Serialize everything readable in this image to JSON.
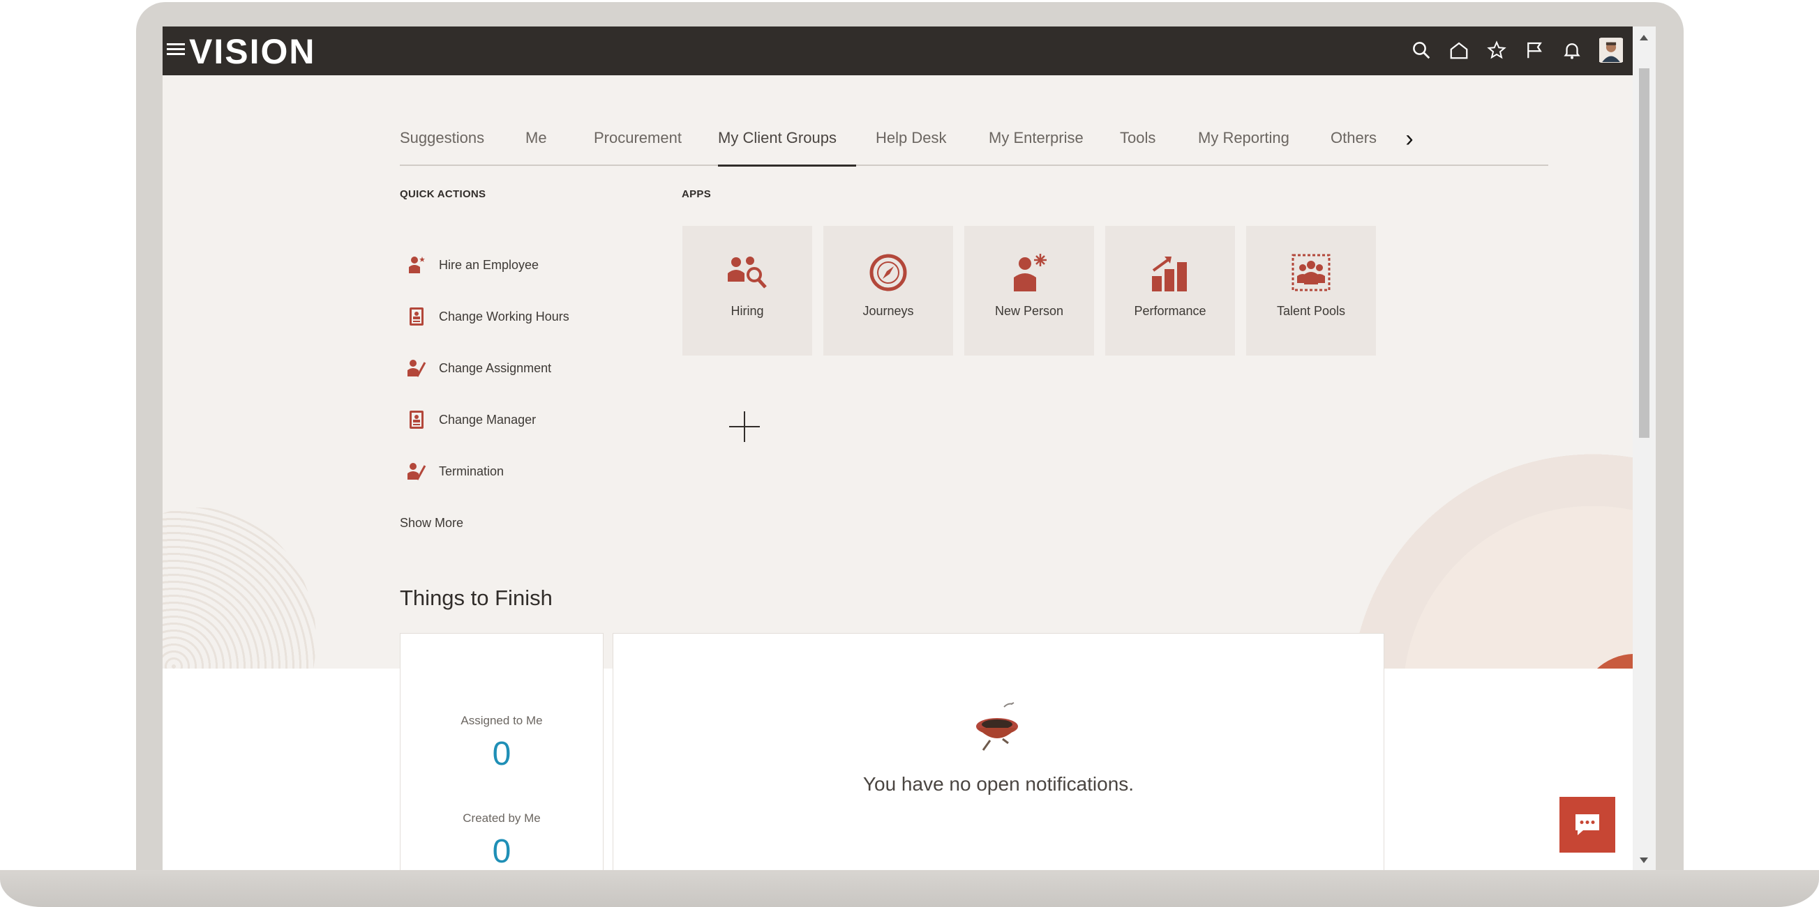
{
  "brand": {
    "logo": "VISION",
    "accent": "#c74634",
    "header_bg": "#312d2a"
  },
  "header": {
    "icons": [
      "search-icon",
      "home-icon",
      "star-icon",
      "flag-icon",
      "bell-icon",
      "avatar"
    ]
  },
  "tabs": [
    {
      "label": "Suggestions"
    },
    {
      "label": "Me"
    },
    {
      "label": "Procurement"
    },
    {
      "label": "My Client Groups",
      "active": true
    },
    {
      "label": "Help Desk"
    },
    {
      "label": "My Enterprise"
    },
    {
      "label": "Tools"
    },
    {
      "label": "My Reporting"
    },
    {
      "label": "Others"
    }
  ],
  "quick_actions": {
    "heading": "QUICK ACTIONS",
    "items": [
      {
        "label": "Hire an Employee",
        "icon": "hire-employee-icon"
      },
      {
        "label": "Change Working Hours",
        "icon": "badge-icon"
      },
      {
        "label": "Change Assignment",
        "icon": "edit-person-icon"
      },
      {
        "label": "Change Manager",
        "icon": "badge-icon"
      },
      {
        "label": "Termination",
        "icon": "edit-person-icon"
      }
    ],
    "show_more": "Show More"
  },
  "apps": {
    "heading": "APPS",
    "items": [
      {
        "label": "Hiring",
        "icon": "hiring-icon"
      },
      {
        "label": "Journeys",
        "icon": "compass-icon"
      },
      {
        "label": "New Person",
        "icon": "new-person-icon"
      },
      {
        "label": "Performance",
        "icon": "bar-chart-icon"
      },
      {
        "label": "Talent Pools",
        "icon": "talent-pool-icon"
      }
    ]
  },
  "things_to_finish": {
    "title": "Things to Finish",
    "assigned_label": "Assigned to Me",
    "assigned_count": "0",
    "created_label": "Created by Me",
    "created_count": "0",
    "empty_message": "You have no open notifications."
  }
}
